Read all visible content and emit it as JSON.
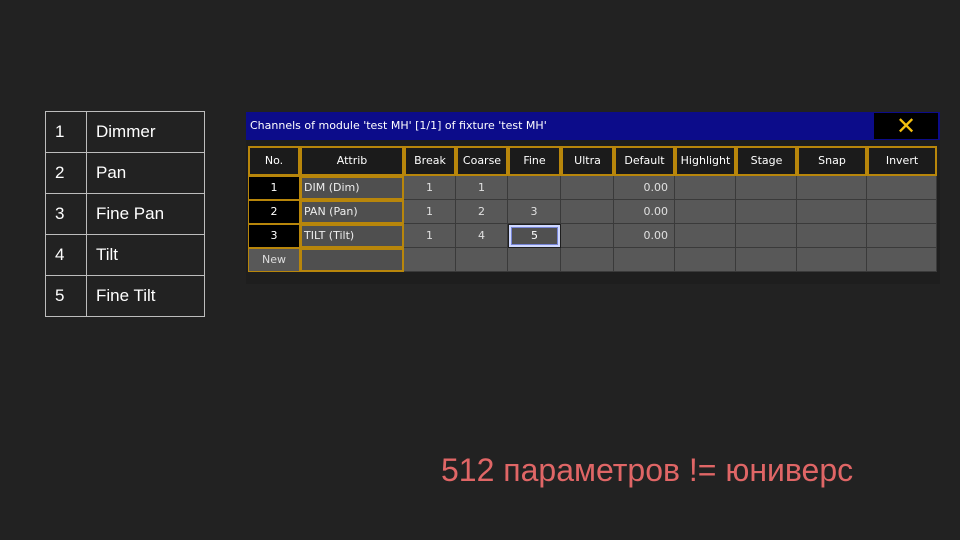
{
  "left_table": [
    {
      "num": "1",
      "name": "Dimmer"
    },
    {
      "num": "2",
      "name": "Pan"
    },
    {
      "num": "3",
      "name": "Fine Pan"
    },
    {
      "num": "4",
      "name": "Tilt"
    },
    {
      "num": "5",
      "name": "Fine Tilt"
    }
  ],
  "window": {
    "title": "Channels of module 'test MH' [1/1] of fixture 'test MH'",
    "close_icon": "✕"
  },
  "grid": {
    "headers": [
      "No.",
      "Attrib",
      "Break",
      "Coarse",
      "Fine",
      "Ultra",
      "Default",
      "Highlight",
      "Stage",
      "Snap",
      "Invert"
    ],
    "rows": [
      {
        "no": "1",
        "attrib": "DIM (Dim)",
        "break": "1",
        "coarse": "1",
        "fine": "",
        "ultra": "",
        "default": "0.00",
        "highlight": "",
        "stage": "",
        "snap": "",
        "invert": ""
      },
      {
        "no": "2",
        "attrib": "PAN (Pan)",
        "break": "1",
        "coarse": "2",
        "fine": "3",
        "ultra": "",
        "default": "0.00",
        "highlight": "",
        "stage": "",
        "snap": "",
        "invert": ""
      },
      {
        "no": "3",
        "attrib": "TILT (Tilt)",
        "break": "1",
        "coarse": "4",
        "fine": "5",
        "ultra": "",
        "default": "0.00",
        "highlight": "",
        "stage": "",
        "snap": "",
        "invert": ""
      }
    ],
    "new_label": "New"
  },
  "footer": "512 параметров != юниверс"
}
